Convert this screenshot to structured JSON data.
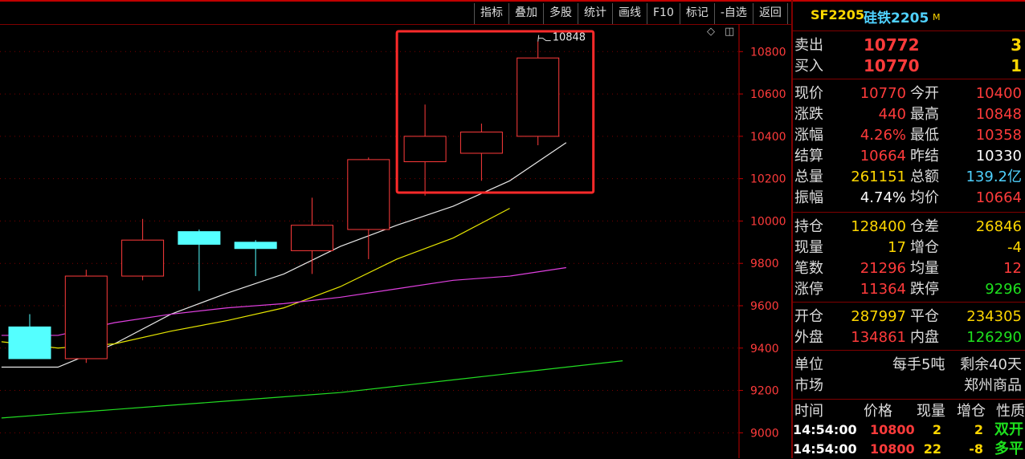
{
  "toolbar": {
    "buttons": [
      "指标",
      "叠加",
      "多股",
      "统计",
      "画线",
      "F10",
      "标记",
      "-自选",
      "返回"
    ]
  },
  "header": {
    "code": "SF2205",
    "name": "硅铁2205",
    "badge": "M"
  },
  "quote": {
    "ask": {
      "label": "卖出",
      "price": "10772",
      "vol": "3"
    },
    "bid": {
      "label": "买入",
      "price": "10770",
      "vol": "1"
    },
    "rows": [
      {
        "l1": "现价",
        "v1": "10770",
        "c1": "red",
        "l2": "今开",
        "v2": "10400",
        "c2": "red"
      },
      {
        "l1": "涨跌",
        "v1": "440",
        "c1": "red",
        "l2": "最高",
        "v2": "10848",
        "c2": "red"
      },
      {
        "l1": "涨幅",
        "v1": "4.26%",
        "c1": "red",
        "l2": "最低",
        "v2": "10358",
        "c2": "red"
      },
      {
        "l1": "结算",
        "v1": "10664",
        "c1": "red",
        "l2": "昨结",
        "v2": "10330",
        "c2": "white"
      },
      {
        "l1": "总量",
        "v1": "261151",
        "c1": "yellow",
        "l2": "总额",
        "v2": "139.2亿",
        "c2": "cyan"
      },
      {
        "l1": "振幅",
        "v1": "4.74%",
        "c1": "white",
        "l2": "均价",
        "v2": "10664",
        "c2": "red"
      }
    ],
    "rows2": [
      {
        "l1": "持仓",
        "v1": "128400",
        "c1": "yellow",
        "l2": "仓差",
        "v2": "26846",
        "c2": "yellow"
      },
      {
        "l1": "现量",
        "v1": "17",
        "c1": "yellow",
        "l2": "增仓",
        "v2": "-4",
        "c2": "yellow"
      },
      {
        "l1": "笔数",
        "v1": "21296",
        "c1": "red",
        "l2": "均量",
        "v2": "12",
        "c2": "red"
      },
      {
        "l1": "涨停",
        "v1": "11364",
        "c1": "red",
        "l2": "跌停",
        "v2": "9296",
        "c2": "green"
      }
    ],
    "rows3": [
      {
        "l1": "开仓",
        "v1": "287997",
        "c1": "yellow",
        "l2": "平仓",
        "v2": "234305",
        "c2": "yellow"
      },
      {
        "l1": "外盘",
        "v1": "134861",
        "c1": "red",
        "l2": "内盘",
        "v2": "126290",
        "c2": "green"
      }
    ],
    "unit": {
      "label": "单位",
      "value1": "每手5吨",
      "value2": "剩余40天"
    },
    "market": {
      "label": "市场",
      "value": "郑州商品"
    }
  },
  "ticks": {
    "headers": [
      "时间",
      "价格",
      "现量",
      "增仓",
      "性质"
    ],
    "rows": [
      {
        "time": "14:54:00",
        "price": "10800",
        "vol": "2",
        "oi": "2",
        "nature": "双开",
        "nature_color": "green"
      },
      {
        "time": "14:54:00",
        "price": "10800",
        "vol": "22",
        "oi": "-8",
        "nature": "多平",
        "nature_color": "green"
      }
    ]
  },
  "chart_data": {
    "type": "candlestick",
    "grid": true,
    "ylim": [
      8880,
      10930
    ],
    "y_ticks": [
      9000,
      9200,
      9400,
      9600,
      9800,
      10000,
      10200,
      10400,
      10600,
      10800
    ],
    "candles": [
      {
        "o": 9500,
        "h": 9560,
        "l": 9410,
        "c": 9350
      },
      {
        "o": 9350,
        "h": 9770,
        "l": 9330,
        "c": 9740
      },
      {
        "o": 9740,
        "h": 10010,
        "l": 9720,
        "c": 9910
      },
      {
        "o": 9950,
        "h": 9960,
        "l": 9670,
        "c": 9890
      },
      {
        "o": 9900,
        "h": 9910,
        "l": 9740,
        "c": 9870
      },
      {
        "o": 9860,
        "h": 10110,
        "l": 9750,
        "c": 9980
      },
      {
        "o": 9960,
        "h": 10300,
        "l": 9820,
        "c": 10290
      },
      {
        "o": 10280,
        "h": 10550,
        "l": 10120,
        "c": 10400
      },
      {
        "o": 10320,
        "h": 10460,
        "l": 10190,
        "c": 10420
      },
      {
        "o": 10400,
        "h": 10848,
        "l": 10358,
        "c": 10770
      }
    ],
    "ma_lines": [
      {
        "color": "#e8e8e8",
        "values": [
          9310,
          9310,
          9420,
          9560,
          9660,
          9750,
          9880,
          9980,
          10070,
          10190,
          10370
        ]
      },
      {
        "color": "#e6e600",
        "values": [
          9430,
          9400,
          9420,
          9480,
          9530,
          9590,
          9690,
          9820,
          9920,
          10060
        ]
      },
      {
        "color": "#e040e0",
        "values": [
          9460,
          9460,
          9520,
          9560,
          9590,
          9610,
          9640,
          9680,
          9720,
          9740,
          9780
        ]
      },
      {
        "color": "#22dd22",
        "values": [
          9070,
          9090,
          9110,
          9130,
          9150,
          9170,
          9190,
          9220,
          9250,
          9280,
          9310,
          9340
        ]
      }
    ],
    "annotation": {
      "label": "10848"
    },
    "highlight_box_color": "#ff2a2a"
  }
}
